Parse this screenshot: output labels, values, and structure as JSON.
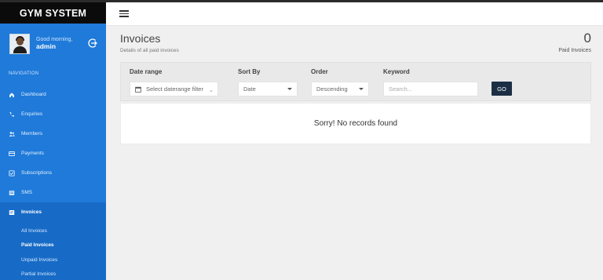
{
  "app": {
    "brand": "GYM SYSTEM"
  },
  "user": {
    "greeting": "Good morning,",
    "name": "admin"
  },
  "sidebar": {
    "section_label": "NAVIGATION",
    "items": [
      {
        "label": "Dashboard",
        "icon": "home-icon"
      },
      {
        "label": "Enquiries",
        "icon": "phone-icon"
      },
      {
        "label": "Members",
        "icon": "users-icon"
      },
      {
        "label": "Payments",
        "icon": "credit-card-icon"
      },
      {
        "label": "Subscriptions",
        "icon": "check-square-icon"
      },
      {
        "label": "SMS",
        "icon": "sms-icon"
      },
      {
        "label": "Invoices",
        "icon": "invoice-icon"
      }
    ],
    "subitems": [
      "All Invoices",
      "Paid Invoices",
      "Unpaid Invoices",
      "Partial Invoices"
    ],
    "active_item": "Invoices",
    "active_subitem": "Paid Invoices"
  },
  "page": {
    "title": "Invoices",
    "subtitle": "Details of all paid invoices",
    "count": "0",
    "count_label": "Paid Invoices"
  },
  "filters": {
    "date_range": {
      "label": "Date range",
      "placeholder": "Select daterange filter"
    },
    "sort_by": {
      "label": "Sort By",
      "value": "Date"
    },
    "order": {
      "label": "Order",
      "value": "Descending"
    },
    "keyword": {
      "label": "Keyword",
      "placeholder": "Search..."
    },
    "go_label": "GO"
  },
  "results": {
    "empty_message": "Sorry! No records found"
  },
  "colors": {
    "sidebar": "#1f7ad9",
    "brand_bar": "#0b0b0b",
    "go_button": "#1b2e44"
  }
}
